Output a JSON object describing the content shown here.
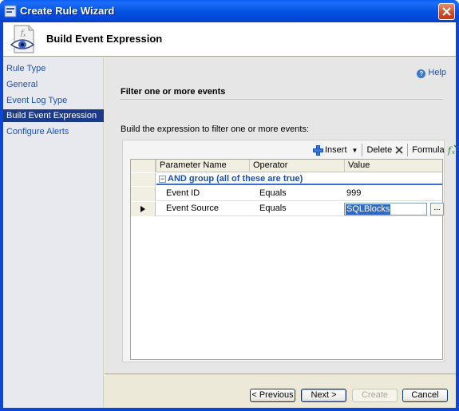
{
  "window": {
    "title": "Create Rule Wizard",
    "colors": {
      "titlebar": "#0453e3",
      "nav_active": "#1c3a8a",
      "link": "#1c4fb4"
    }
  },
  "header": {
    "title": "Build Event Expression",
    "icon": "eye-document-icon"
  },
  "nav": {
    "items": [
      {
        "label": "Rule Type",
        "active": false
      },
      {
        "label": "General",
        "active": false
      },
      {
        "label": "Event Log Type",
        "active": false
      },
      {
        "label": "Build Event Expression",
        "active": true
      },
      {
        "label": "Configure Alerts",
        "active": false
      }
    ]
  },
  "help": {
    "label": "Help"
  },
  "section": {
    "title": "Filter one or more events",
    "description": "Build the expression to filter one or more events:"
  },
  "toolbar": {
    "insert_label": "Insert",
    "delete_label": "Delete",
    "formula_label": "Formula"
  },
  "grid": {
    "columns": [
      "Parameter Name",
      "Operator",
      "Value"
    ],
    "group_label": "AND group (all of these are true)",
    "rows": [
      {
        "parameter": "Event ID",
        "operator": "Equals",
        "value": "999"
      },
      {
        "parameter": "Event Source",
        "operator": "Equals",
        "value": "SQLBlocks"
      }
    ],
    "ellipsis_label": "..."
  },
  "buttons": {
    "previous": "< Previous",
    "next": "Next >",
    "create": "Create",
    "cancel": "Cancel"
  }
}
